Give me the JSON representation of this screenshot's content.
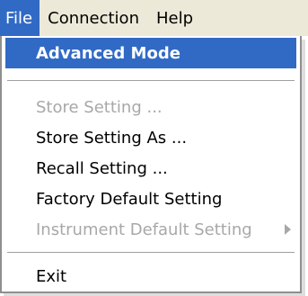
{
  "menubar": {
    "items": [
      {
        "label": "File"
      },
      {
        "label": "Connection"
      },
      {
        "label": "Help"
      }
    ]
  },
  "file_menu": {
    "items": [
      {
        "label": "Advanced Mode",
        "state": "highlighted"
      },
      {
        "label": "Store Setting ...",
        "state": "disabled"
      },
      {
        "label": "Store Setting As ...",
        "state": "enabled"
      },
      {
        "label": "Recall Setting ...",
        "state": "enabled"
      },
      {
        "label": "Factory Default Setting",
        "state": "enabled"
      },
      {
        "label": "Instrument Default Setting",
        "state": "disabled",
        "has_submenu": true
      },
      {
        "label": "Exit",
        "state": "enabled"
      }
    ]
  },
  "colors": {
    "highlight": "#316ac5",
    "menubar_bg": "#ece9d8",
    "disabled_text": "#a8a8a8"
  }
}
